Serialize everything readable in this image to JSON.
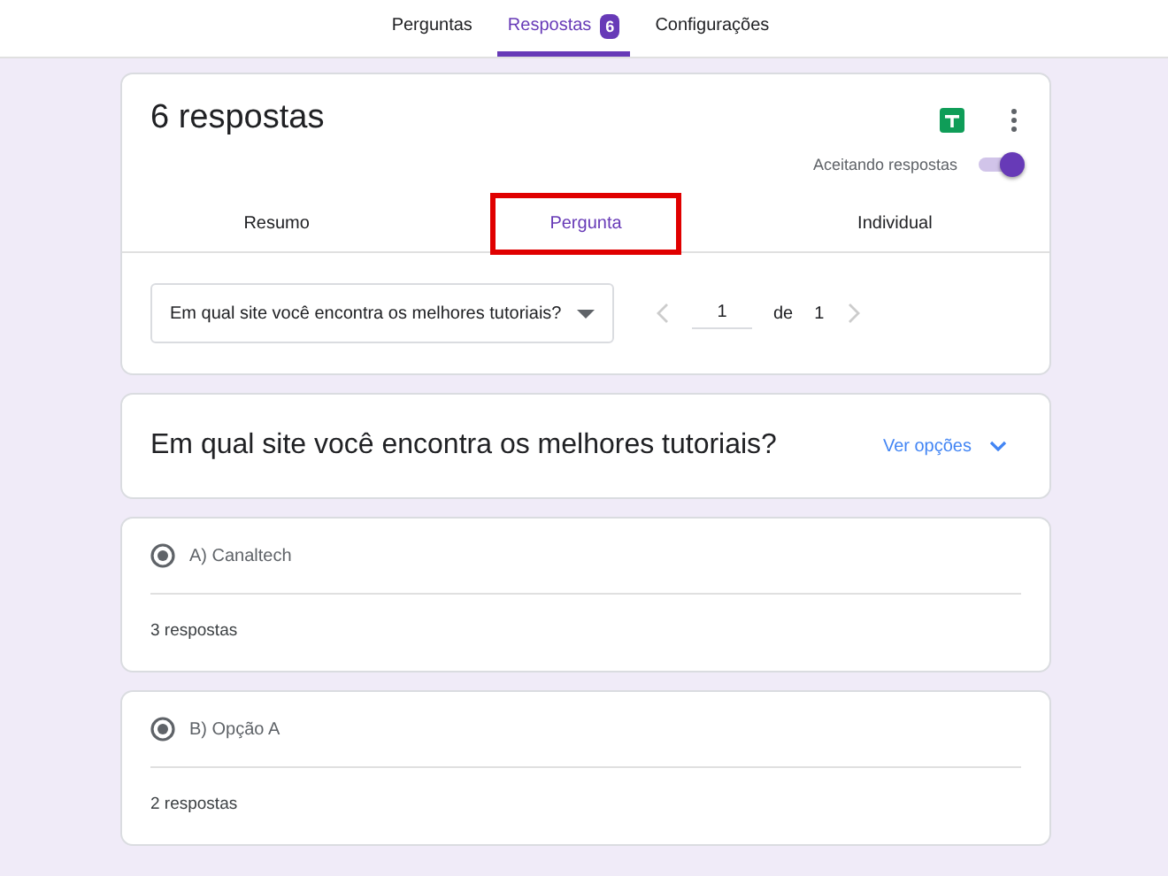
{
  "top_tabs": [
    {
      "label": "Perguntas",
      "selected": false
    },
    {
      "label": "Respostas",
      "selected": true,
      "badge": "6"
    },
    {
      "label": "Configurações",
      "selected": false
    }
  ],
  "summary": {
    "title": "6 respostas",
    "accepting_label": "Aceitando respostas",
    "accepting_on": true,
    "view_tabs": [
      {
        "label": "Resumo",
        "selected": false,
        "highlighted": false
      },
      {
        "label": "Pergunta",
        "selected": true,
        "highlighted": true
      },
      {
        "label": "Individual",
        "selected": false,
        "highlighted": false
      }
    ],
    "question_select": "Em qual site você encontra os melhores tutoriais?",
    "pager": {
      "current": "1",
      "of_label": "de",
      "total": "1"
    }
  },
  "question": {
    "title": "Em qual site você encontra os melhores tutoriais?",
    "options_link": "Ver opções"
  },
  "answers": [
    {
      "option": "A) Canaltech",
      "checked": true,
      "count": "3 respostas"
    },
    {
      "option": "B) Opção A",
      "checked": true,
      "count": "2 respostas"
    }
  ]
}
